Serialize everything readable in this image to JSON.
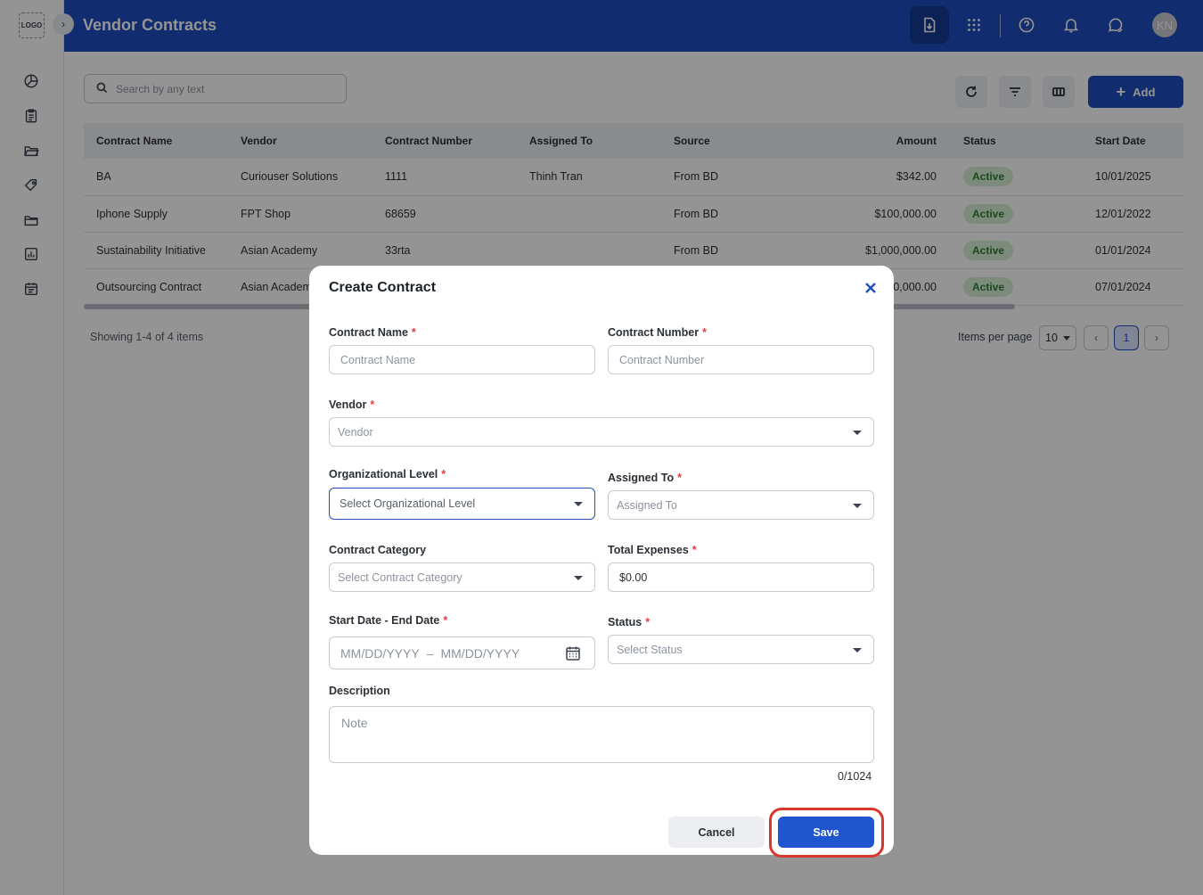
{
  "app": {
    "logo_text": "LOGO",
    "title": "Vendor Contracts",
    "user_initials": "KN",
    "brand_color": "#1f4fbf"
  },
  "sidebar": {
    "items": [
      {
        "icon": "pie-chart-icon"
      },
      {
        "icon": "clipboard-icon"
      },
      {
        "icon": "folder-open-icon"
      },
      {
        "icon": "tag-icon"
      },
      {
        "icon": "folder-icon"
      },
      {
        "icon": "report-chart-icon"
      },
      {
        "icon": "calendar-icon"
      }
    ]
  },
  "header": {
    "icons": [
      "download-document-icon",
      "apps-grid-icon",
      "help-icon",
      "bell-icon",
      "chat-icon"
    ]
  },
  "toolbar": {
    "search_placeholder": "Search by any text",
    "add_label": "Add"
  },
  "table": {
    "columns": [
      "Contract Name",
      "Vendor",
      "Contract Number",
      "Assigned To",
      "Source",
      "Amount",
      "Status",
      "Start Date"
    ],
    "rows": [
      {
        "name": "BA",
        "vendor": "Curiouser Solutions",
        "number": "1111",
        "assigned": "Thinh Tran",
        "source": "From BD",
        "amount": "$342.00",
        "status": "Active",
        "start": "10/01/2025"
      },
      {
        "name": "Iphone Supply",
        "vendor": "FPT Shop",
        "number": "68659",
        "assigned": "",
        "source": "From BD",
        "amount": "$100,000.00",
        "status": "Active",
        "start": "12/01/2022"
      },
      {
        "name": "Sustainability Initiative",
        "vendor": "Asian Academy",
        "number": "33rta",
        "assigned": "",
        "source": "From BD",
        "amount": "$1,000,000.00",
        "status": "Active",
        "start": "01/01/2024"
      },
      {
        "name": "Outsourcing Contract",
        "vendor": "Asian Academ",
        "number": "",
        "assigned": "",
        "source": "",
        "amount": "0,000.00",
        "status": "Active",
        "start": "07/01/2024"
      }
    ],
    "status_color": "#2e7d32"
  },
  "pagination": {
    "showing": "Showing 1-4 of 4 items",
    "items_per_page_label": "Items per page",
    "items_per_page": "10",
    "current_page": "1"
  },
  "modal": {
    "title": "Create Contract",
    "fields": {
      "contract_name": {
        "label": "Contract Name",
        "placeholder": "Contract Name"
      },
      "contract_number": {
        "label": "Contract Number",
        "placeholder": "Contract Number"
      },
      "vendor": {
        "label": "Vendor",
        "placeholder": "Vendor"
      },
      "org_level": {
        "label": "Organizational Level",
        "placeholder": "Select Organizational Level"
      },
      "assigned_to": {
        "label": "Assigned To",
        "placeholder": "Assigned To"
      },
      "category": {
        "label": "Contract Category",
        "placeholder": "Select Contract Category"
      },
      "total_expenses": {
        "label": "Total Expenses",
        "value": "$0.00"
      },
      "date_range": {
        "label": "Start Date - End Date",
        "start_placeholder": "MM/DD/YYYY",
        "separator": "–",
        "end_placeholder": "MM/DD/YYYY"
      },
      "status": {
        "label": "Status",
        "placeholder": "Select Status"
      },
      "description": {
        "label": "Description",
        "placeholder": "Note",
        "counter": "0/1024"
      }
    },
    "required_mark": "*",
    "cancel_label": "Cancel",
    "save_label": "Save",
    "highlight_color": "#d9372b"
  }
}
